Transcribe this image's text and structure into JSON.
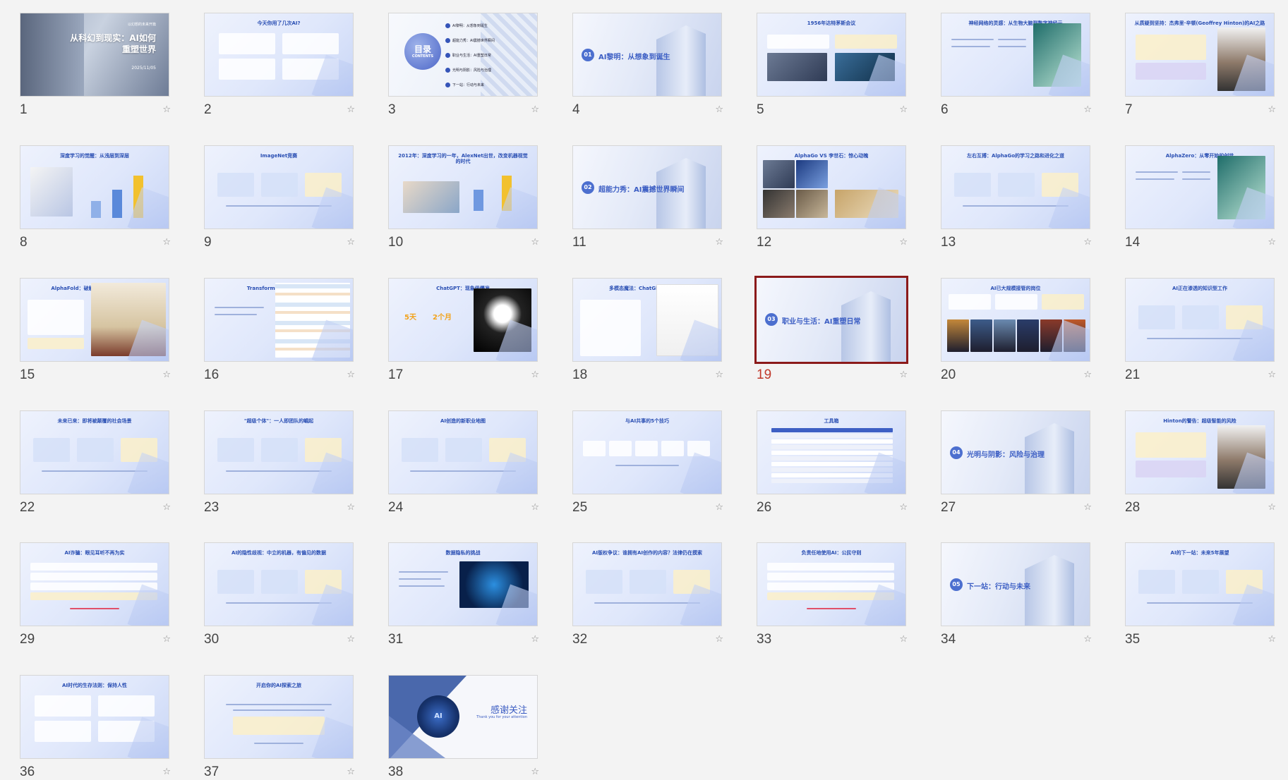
{
  "selected_slide": 19,
  "slides": [
    {
      "num": "1",
      "kind": "cover",
      "title": "从科幻到现实：AI如何\n重塑世界",
      "subtitle": "以幻想的未来开篇",
      "date": "2025/11/05"
    },
    {
      "num": "2",
      "kind": "content",
      "title": "今天你用了几次AI?",
      "layout": "grid4"
    },
    {
      "num": "3",
      "kind": "toc",
      "title": "目录",
      "subtitle": "CONTENTS",
      "items": [
        "AI黎明：从想象到诞生",
        "超能力秀：AI震撼世界瞬间",
        "职业与生活：AI重塑日常",
        "光明与阴影：风险与治理",
        "下一站：行动与未来"
      ]
    },
    {
      "num": "4",
      "kind": "section",
      "sec": "01",
      "title": "AI黎明：从想象到诞生"
    },
    {
      "num": "5",
      "kind": "content",
      "title": "1956年达特茅斯会议",
      "layout": "two-pics"
    },
    {
      "num": "6",
      "kind": "content",
      "title": "神经网络的灵感：从生物大脑到数字神经元",
      "layout": "text-pic-right"
    },
    {
      "num": "7",
      "kind": "content",
      "title": "从质疑到坚持：杰弗里·辛顿(Geoffrey Hinton)的AI之路",
      "layout": "text-person"
    },
    {
      "num": "8",
      "kind": "content",
      "title": "深度学习的觉醒：从浅层到深层",
      "layout": "bars"
    },
    {
      "num": "9",
      "kind": "content",
      "title": "ImageNet竞赛",
      "layout": "grid3"
    },
    {
      "num": "10",
      "kind": "content",
      "title": "2012年：深度学习的一年，AlexNet出世，改变机器视觉的时代",
      "layout": "bars2"
    },
    {
      "num": "11",
      "kind": "section",
      "sec": "02",
      "title": "超能力秀：AI震撼世界瞬间"
    },
    {
      "num": "12",
      "kind": "content",
      "title": "AlphaGo VS 李世石：惊心动魄",
      "layout": "photo-grid"
    },
    {
      "num": "13",
      "kind": "content",
      "title": "左右互搏：AlphaGo的学习之路和进化之道",
      "layout": "grid3"
    },
    {
      "num": "14",
      "kind": "content",
      "title": "AlphaZero：从零开始的创世",
      "layout": "text-pic-right"
    },
    {
      "num": "15",
      "kind": "content",
      "title": "AlphaFold：破解生命密码，荣获诺奖",
      "layout": "nobel"
    },
    {
      "num": "16",
      "kind": "content",
      "title": "Transformer：注意力革命",
      "layout": "diagram"
    },
    {
      "num": "17",
      "kind": "content",
      "title": "ChatGPT：现象级爆发",
      "layout": "stats-photo",
      "stat1": "5天",
      "stat2": "2个月"
    },
    {
      "num": "18",
      "kind": "content",
      "title": "多模态魔法：ChatGPT能做什么?",
      "layout": "chart-right"
    },
    {
      "num": "19",
      "kind": "section",
      "sec": "03",
      "title": "职业与生活：AI重塑日常"
    },
    {
      "num": "20",
      "kind": "content",
      "title": "AI已大规模接管的岗位",
      "layout": "art-row"
    },
    {
      "num": "21",
      "kind": "content",
      "title": "AI正在渗透的知识型工作",
      "layout": "grid3"
    },
    {
      "num": "22",
      "kind": "content",
      "title": "未来已来：即将被颠覆的社会场景",
      "layout": "grid3"
    },
    {
      "num": "23",
      "kind": "content",
      "title": "\"超级个体\"：一人即团队的崛起",
      "layout": "grid3"
    },
    {
      "num": "24",
      "kind": "content",
      "title": "AI创造的新职业地图",
      "layout": "grid3"
    },
    {
      "num": "25",
      "kind": "content",
      "title": "与AI共事的5个技巧",
      "layout": "grid5"
    },
    {
      "num": "26",
      "kind": "content",
      "title": "工具箱",
      "layout": "table"
    },
    {
      "num": "27",
      "kind": "section",
      "sec": "04",
      "title": "光明与阴影：风险与治理"
    },
    {
      "num": "28",
      "kind": "content",
      "title": "Hinton的警告：超级智能的风险",
      "layout": "text-person"
    },
    {
      "num": "29",
      "kind": "content",
      "title": "AI诈骗：眼见耳听不再为实",
      "layout": "list"
    },
    {
      "num": "30",
      "kind": "content",
      "title": "AI的隐性歧视：中立的机器，有偏见的数据",
      "layout": "grid3"
    },
    {
      "num": "31",
      "kind": "content",
      "title": "数据隐私的挑战",
      "layout": "text-pic-dark"
    },
    {
      "num": "32",
      "kind": "content",
      "title": "AI版权争议：谁拥有AI创作的内容？法律仍在摸索",
      "layout": "grid3"
    },
    {
      "num": "33",
      "kind": "content",
      "title": "负责任地使用AI：公民守则",
      "layout": "list2"
    },
    {
      "num": "34",
      "kind": "section",
      "sec": "05",
      "title": "下一站：行动与未来"
    },
    {
      "num": "35",
      "kind": "content",
      "title": "AI的下一站：未来5年展望",
      "layout": "grid3"
    },
    {
      "num": "36",
      "kind": "content",
      "title": "AI时代的生存法则：保持人性",
      "layout": "grid4"
    },
    {
      "num": "37",
      "kind": "content",
      "title": "开启你的AI探索之旅",
      "layout": "quote"
    },
    {
      "num": "38",
      "kind": "thanks",
      "title": "感谢关注",
      "subtitle": "Thank you for your attention",
      "badge": "AI"
    }
  ],
  "star_icon": "☆",
  "colors": {
    "selection": "#8b1a1a",
    "accent": "#3d5fc4",
    "background": "#f3f3f3"
  }
}
